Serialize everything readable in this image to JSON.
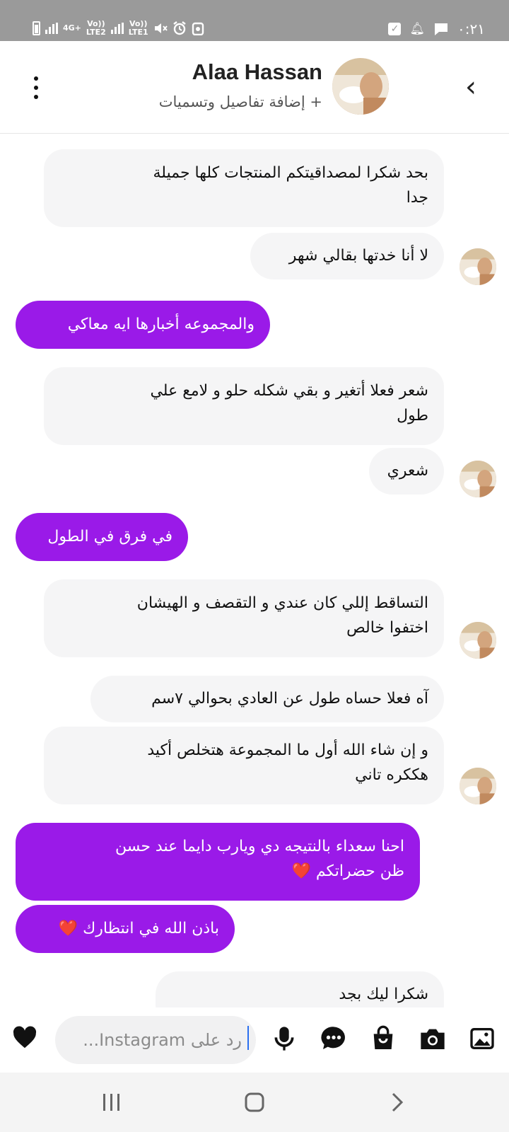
{
  "status_bar": {
    "net1": "4G+",
    "net2_top": "Vo))",
    "net2_bottom": "LTE2",
    "net3_top": "Vo))",
    "net3_bottom": "LTE1",
    "time": "٠:٢١"
  },
  "header": {
    "name": "Alaa Hassan",
    "subtitle": "+ إضافة تفاصيل وتسميات"
  },
  "messages": [
    {
      "side": "in",
      "text": "بحد شكرا لمصداقيتكم المنتجات كلها جميلة\nجدا"
    },
    {
      "side": "in",
      "text": "لا أنا خدتها بقالي شهر"
    },
    {
      "side": "out",
      "text": "والمجموعه أخبارها ايه معاكي"
    },
    {
      "side": "in",
      "text": "شعر فعلا أتغير و بقي شكله حلو و لامع علي\nطول"
    },
    {
      "side": "in",
      "text": "شعري"
    },
    {
      "side": "out",
      "text": "في فرق في الطول"
    },
    {
      "side": "in",
      "text": "التساقط إللي كان عندي و التقصف و الهيشان\nاختفوا خالص"
    },
    {
      "side": "in",
      "text": "آه فعلا حساه طول عن العادي بحوالي ٧سم"
    },
    {
      "side": "in",
      "text": "و إن شاء الله أول ما المجموعة هتخلص أكيد\nهككره تاني"
    },
    {
      "side": "out",
      "text": "احنا سعداء بالنتيجه دي ويارب دايما عند حسن\nظن حضراتكم ❤️"
    },
    {
      "side": "out",
      "text": "باذن الله في انتظارك ❤️"
    },
    {
      "side": "in",
      "text": "شكرا ليك بجد"
    }
  ],
  "composer": {
    "placeholder": "رد على Instagram..."
  },
  "colors": {
    "outgoing_bubble": "#9a1ae8",
    "incoming_bubble": "#f5f5f6",
    "status_bar": "#9a9a9a",
    "caret": "#2a6ff0"
  },
  "icons": {
    "status": [
      "battery-icon",
      "signal-icon",
      "mute-icon",
      "alarm-icon",
      "clipboard-icon",
      "check-icon",
      "bell-icon",
      "chat-icon"
    ],
    "header": [
      "kebab-menu-icon",
      "back-icon"
    ],
    "composer": [
      "heart-icon",
      "microphone-icon",
      "sticker-icon",
      "shopping-bag-icon",
      "camera-icon",
      "gallery-icon"
    ],
    "nav": [
      "recent-apps-icon",
      "home-icon",
      "back-nav-icon"
    ]
  }
}
